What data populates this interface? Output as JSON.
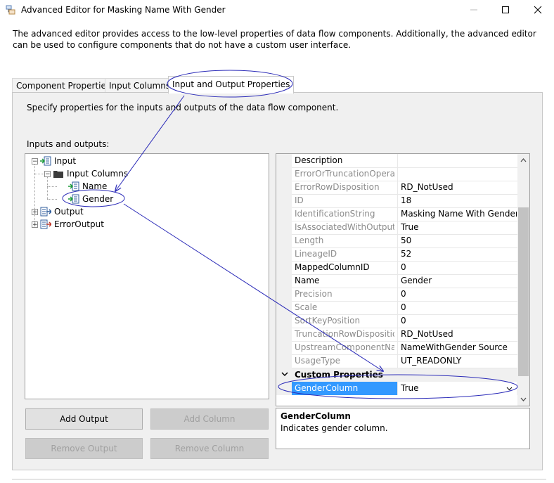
{
  "window": {
    "title": "Advanced Editor for Masking Name With Gender",
    "description": "The advanced editor provides access to the low-level properties of data flow components. Additionally, the advanced editor can be used to configure components that do not have a custom user interface."
  },
  "tabs": [
    {
      "label": "Component Properties"
    },
    {
      "label": "Input Columns"
    },
    {
      "label": "Input and Output Properties"
    }
  ],
  "panel": {
    "instruction": "Specify properties for the inputs and outputs of the data flow component.",
    "tree_label": "Inputs and outputs:"
  },
  "tree": {
    "input": "Input",
    "input_columns": "Input Columns",
    "col_name": "Name",
    "col_gender": "Gender",
    "output": "Output",
    "error_output": "ErrorOutput"
  },
  "properties": {
    "rows": [
      {
        "name": "Description",
        "value": ""
      },
      {
        "name": "ErrorOrTruncationOperation",
        "value": ""
      },
      {
        "name": "ErrorRowDisposition",
        "value": "RD_NotUsed"
      },
      {
        "name": "ID",
        "value": "18"
      },
      {
        "name": "IdentificationString",
        "value": "Masking Name With Gender.Inp"
      },
      {
        "name": "IsAssociatedWithOutputColumn",
        "value": "True"
      },
      {
        "name": "Length",
        "value": "50"
      },
      {
        "name": "LineageID",
        "value": "52"
      },
      {
        "name": "MappedColumnID",
        "value": "0"
      },
      {
        "name": "Name",
        "value": "Gender"
      },
      {
        "name": "Precision",
        "value": "0"
      },
      {
        "name": "Scale",
        "value": "0"
      },
      {
        "name": "SortKeyPosition",
        "value": "0"
      },
      {
        "name": "TruncationRowDisposition",
        "value": "RD_NotUsed"
      },
      {
        "name": "UpstreamComponentName",
        "value": "NameWithGender Source"
      },
      {
        "name": "UsageType",
        "value": "UT_READONLY"
      }
    ],
    "category": "Custom Properties",
    "custom_name": "GenderColumn",
    "custom_value": "True"
  },
  "help": {
    "title": "GenderColumn",
    "text": "Indicates gender column."
  },
  "buttons": {
    "add_output": "Add Output",
    "add_column": "Add Column",
    "remove_output": "Remove Output",
    "remove_column": "Remove Column"
  },
  "colors": {
    "selection": "#3399ff",
    "annotation": "#2b2bb8"
  }
}
